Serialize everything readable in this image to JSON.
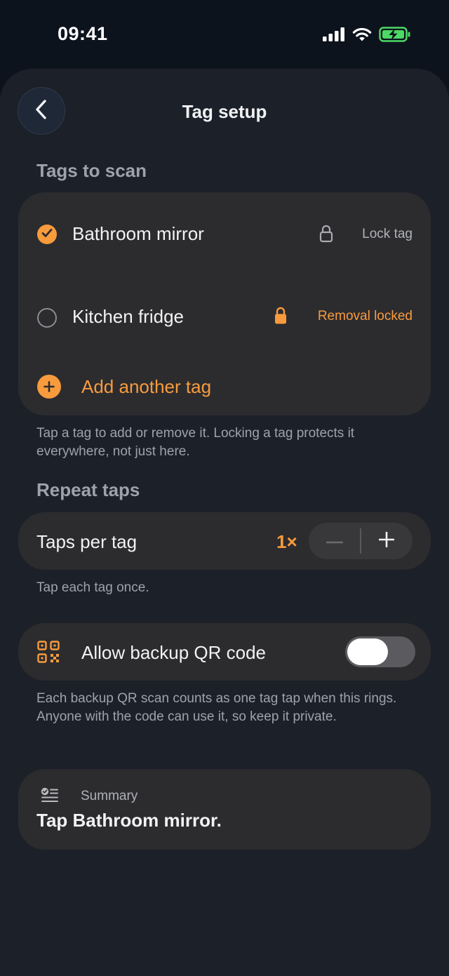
{
  "status_bar": {
    "time": "09:41"
  },
  "header": {
    "title": "Tag setup"
  },
  "tags_section": {
    "heading": "Tags to scan",
    "tags": [
      {
        "name": "Bathroom mirror",
        "selected": true,
        "lock_label": "Lock tag",
        "locked": false
      },
      {
        "name": "Kitchen fridge",
        "selected": false,
        "lock_label": "Removal locked",
        "locked": true
      }
    ],
    "add_label": "Add another tag",
    "hint": "Tap a tag to add or remove it. Locking a tag protects it everywhere, not just here."
  },
  "repeat_section": {
    "heading": "Repeat taps",
    "label": "Taps per tag",
    "value": "1×",
    "hint": "Tap each tag once."
  },
  "backup": {
    "label": "Allow backup QR code",
    "enabled": false,
    "hint": "Each backup QR scan counts as one tag tap when this rings. Anyone with the code can use it, so keep it private."
  },
  "summary": {
    "caption": "Summary",
    "text": "Tap Bathroom mirror."
  },
  "colors": {
    "accent": "#f89b3d",
    "background": "#0d131d",
    "sheet": "#1c2028",
    "card": "#2c2c2f",
    "battery": "#4cd964"
  },
  "icons": {
    "back": "chevron-left-icon",
    "lock": "lock-icon",
    "add": "plus-circle-icon",
    "qr": "qr-code-icon",
    "summary": "checklist-icon"
  }
}
